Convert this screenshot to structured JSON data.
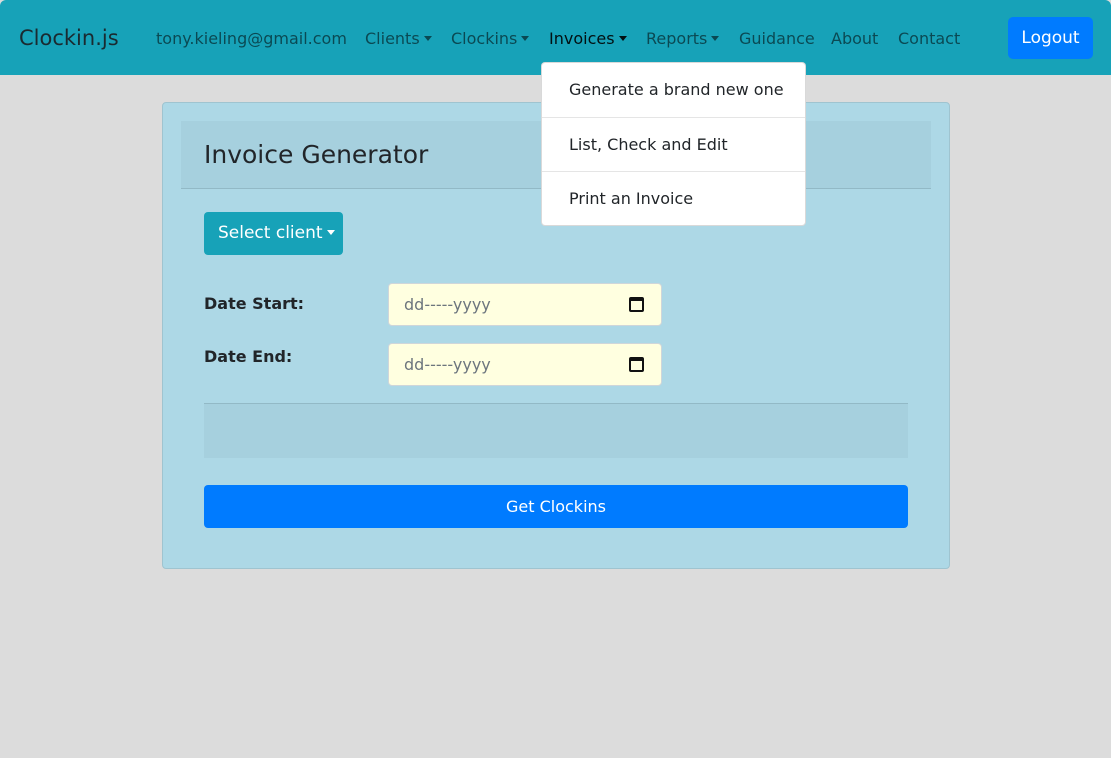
{
  "navbar": {
    "brand": "Clockin.js",
    "user_email": "tony.kieling@gmail.com",
    "clients": "Clients",
    "clockins": "Clockins",
    "invoices": "Invoices",
    "reports": "Reports",
    "guidance": "Guidance",
    "about": "About",
    "contact": "Contact",
    "logout": "Logout"
  },
  "invoices_menu": {
    "items": [
      "Generate a brand new one",
      "List, Check and Edit",
      "Print an Invoice"
    ]
  },
  "invoice_form": {
    "title": "Invoice Generator",
    "select_client": "Select client",
    "date_start_label": "Date Start:",
    "date_end_label": "Date End:",
    "date_start_value": "dd-----yyyy",
    "date_end_value": "dd-----yyyy",
    "submit": "Get Clockins"
  },
  "colors": {
    "navbar": "#17a2b8",
    "primary": "#007bff",
    "card": "#add8e6",
    "date_input": "#ffffe0"
  },
  "icons": [
    "caret-down-icon",
    "calendar-icon"
  ]
}
